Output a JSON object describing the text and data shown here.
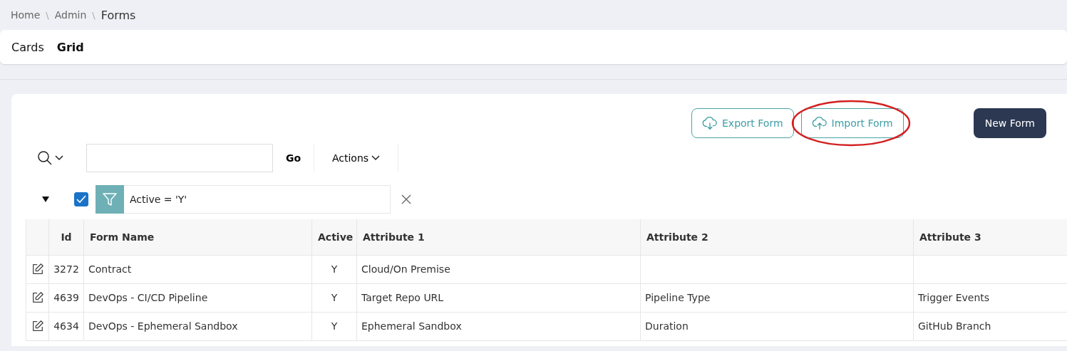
{
  "breadcrumb": [
    {
      "label": "Home",
      "current": false
    },
    {
      "label": "Admin",
      "current": false
    },
    {
      "label": "Forms",
      "current": true
    }
  ],
  "breadcrumb_separator": "\\",
  "tabs": [
    {
      "label": "Cards",
      "selected": false
    },
    {
      "label": "Grid",
      "selected": true
    }
  ],
  "buttons": [
    {
      "kind": "export",
      "label": "Export Form",
      "highlighted": false
    },
    {
      "kind": "import",
      "label": "Import Form",
      "highlighted": true
    },
    {
      "kind": "primary",
      "label": "New Form",
      "highlighted": false
    }
  ],
  "search": {
    "go_label": "Go",
    "actions_label": "Actions"
  },
  "filter": {
    "expanded": true,
    "checked": true,
    "text": "Active = 'Y'"
  },
  "table": {
    "columns": [
      "Id",
      "Form Name",
      "Active",
      "Attribute 1",
      "Attribute 2",
      "Attribute 3"
    ],
    "rows": [
      {
        "cells": [
          "3272",
          "Contract",
          "Y",
          "Cloud/On Premise",
          "",
          ""
        ]
      },
      {
        "cells": [
          "4639",
          "DevOps - CI/CD Pipeline",
          "Y",
          "Target Repo URL",
          "Pipeline Type",
          "Trigger Events"
        ]
      },
      {
        "cells": [
          "4634",
          "DevOps - Ephemeral Sandbox",
          "Y",
          "Ephemeral Sandbox",
          "Duration",
          "GitHub Branch"
        ]
      }
    ]
  }
}
